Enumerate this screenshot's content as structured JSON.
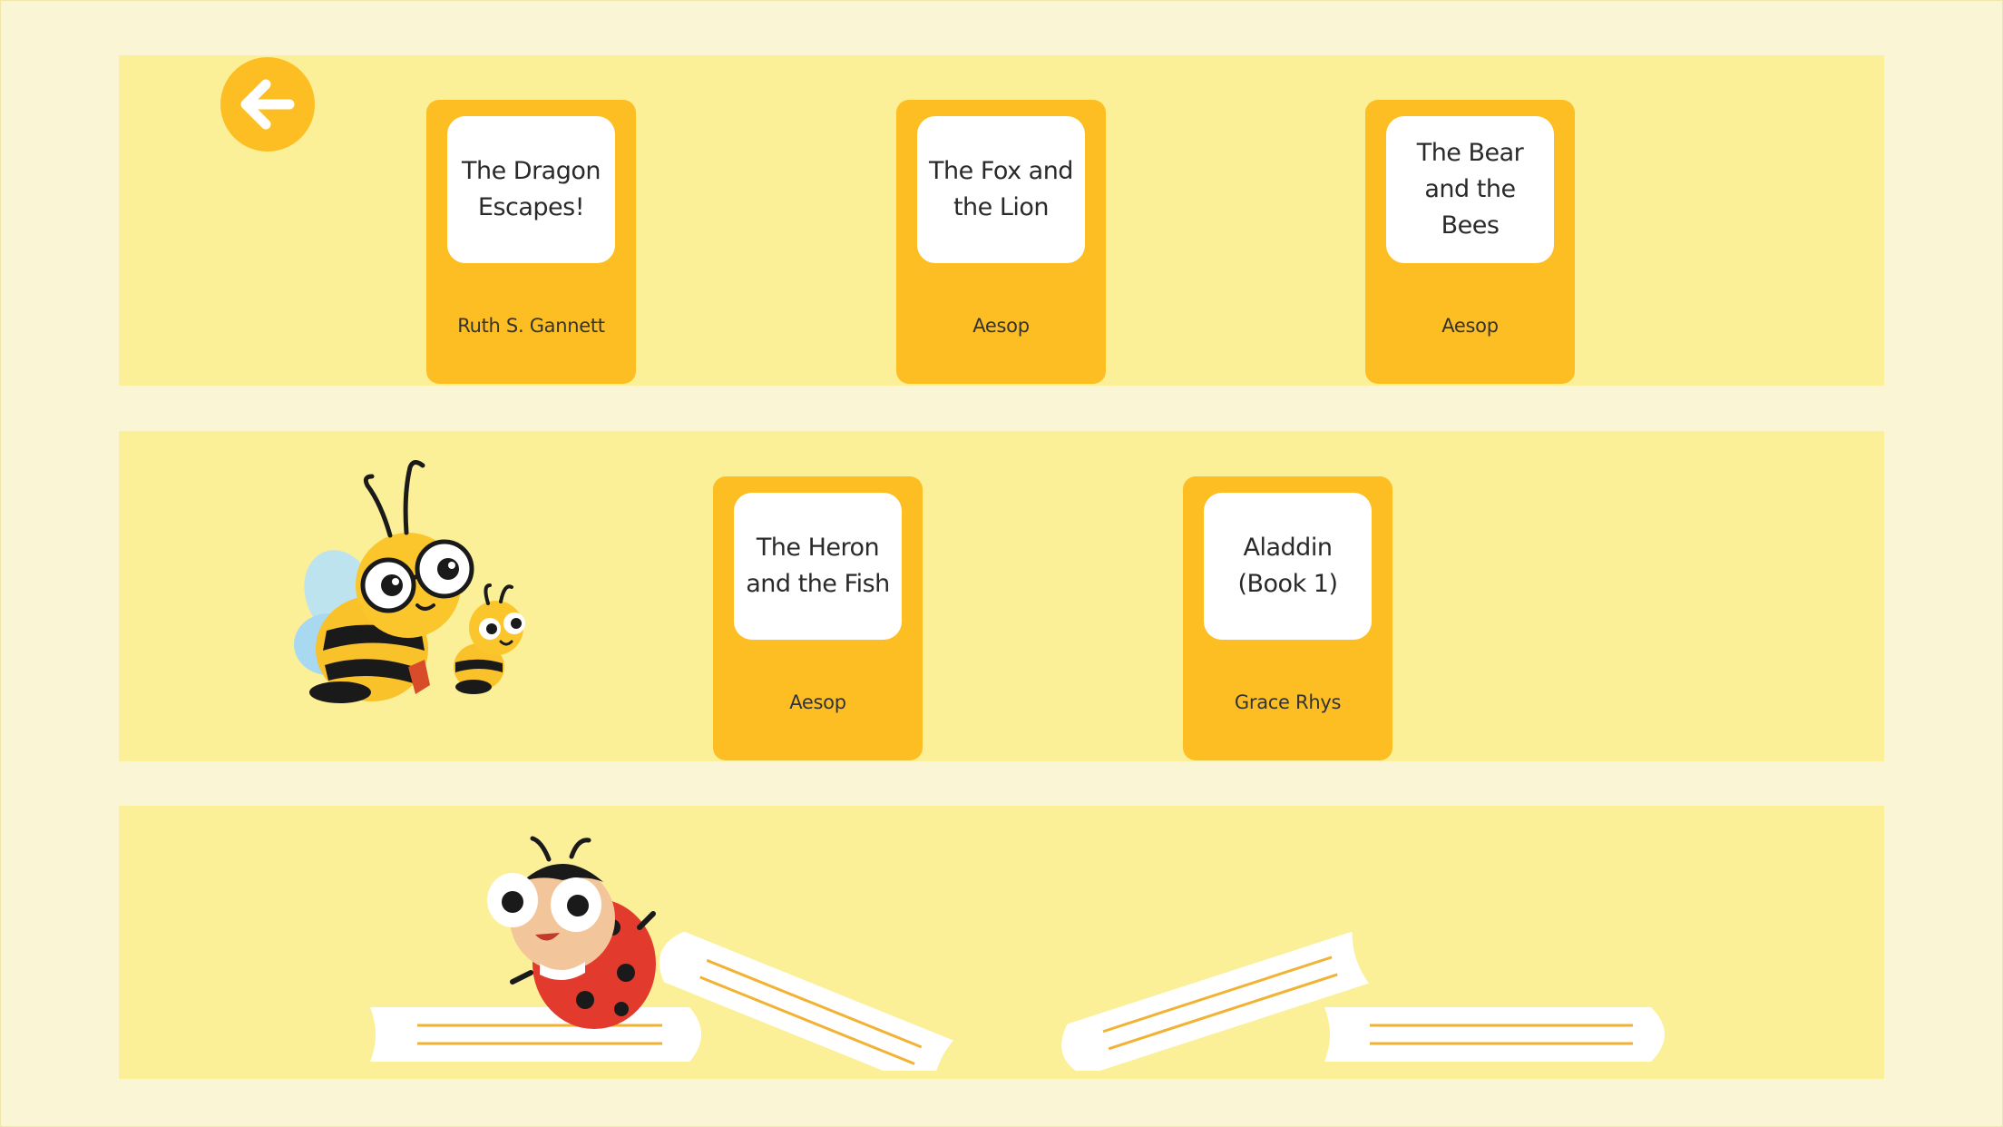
{
  "icons": {
    "back": "arrow-left-icon",
    "bees": "bee-characters-illustration",
    "ladybug": "ladybug-character-illustration",
    "books": "closed-books-illustration"
  },
  "colors": {
    "background": "#faf5d4",
    "shelf": "#fbf097",
    "book": "#fdbe24",
    "cover": "#ffffff"
  },
  "shelves": [
    {
      "books": [
        {
          "title": "The Dragon Escapes!",
          "author": "Ruth S. Gannett"
        },
        {
          "title": "The Fox and the Lion",
          "author": "Aesop"
        },
        {
          "title": "The Bear and the Bees",
          "author": "Aesop"
        }
      ]
    },
    {
      "books": [
        {
          "title": "The Heron and the Fish",
          "author": "Aesop"
        },
        {
          "title": "Aladdin (Book 1)",
          "author": "Grace Rhys"
        }
      ]
    }
  ]
}
